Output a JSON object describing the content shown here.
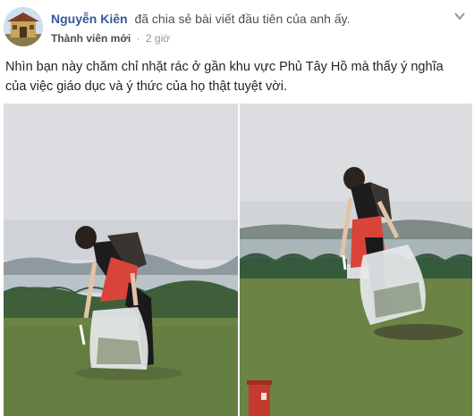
{
  "post": {
    "author_name": "Nguyễn Kiên",
    "action_text": "đã chia sẻ bài viết đầu tiên của anh ấy.",
    "badge": "Thành viên mới",
    "separator": "·",
    "time": "2 giờ",
    "body": "Nhìn bạn này chăm chỉ nhặt rác ở gần khu vực Phủ Tây Hồ mà thấy ý nghĩa của việc giáo dục và ý thức của họ thật tuyệt vời."
  },
  "icons": {
    "avatar": "avatar-temple-gate",
    "menu": "chevron-down-icon"
  },
  "colors": {
    "author_link": "#365899",
    "meta_text": "#90949c",
    "body_text": "#1d2129",
    "sky": "#dcdde0",
    "grass": "#5f7a3f",
    "shirt": "#d9433a"
  }
}
